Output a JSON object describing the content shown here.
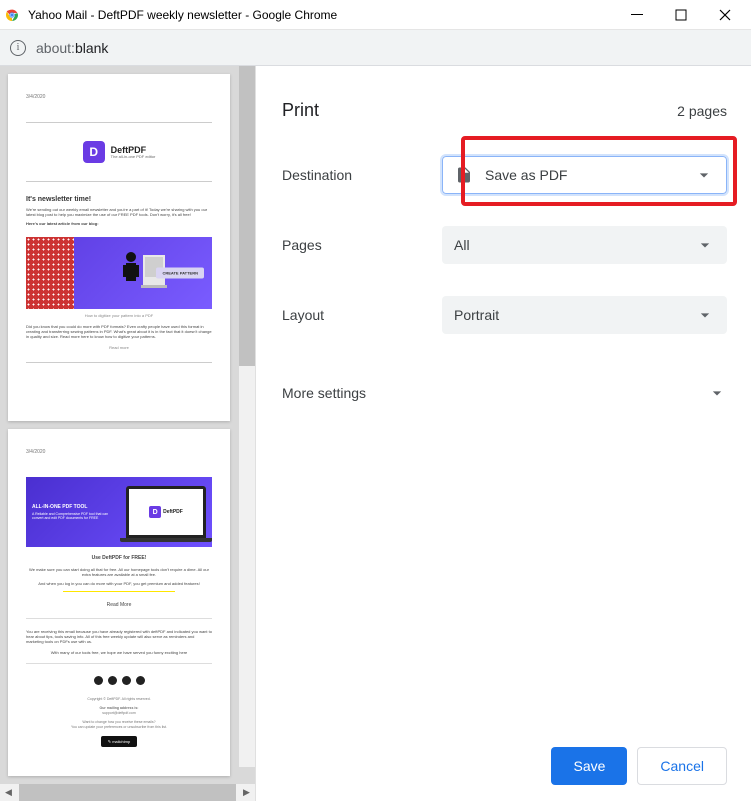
{
  "window": {
    "title": "Yahoo Mail - DeftPDF weekly newsletter - Google Chrome"
  },
  "address": {
    "about_prefix": "about:",
    "path": "blank"
  },
  "print": {
    "heading": "Print",
    "page_summary": "2 pages",
    "destination_label": "Destination",
    "destination_value": "Save as PDF",
    "pages_label": "Pages",
    "pages_value": "All",
    "layout_label": "Layout",
    "layout_value": "Portrait",
    "more_settings_label": "More settings",
    "save_btn": "Save",
    "cancel_btn": "Cancel"
  },
  "thumb1": {
    "logo_name": "DeftPDF",
    "logo_sub": "The all-in-one PDF editor",
    "h1": "It's newsletter time!",
    "p1": "We're sending out our weekly email newsletter and you're a part of it! Today we're sharing with you our latest blog post to help you maximize the use of our FREE PDF tools. Don't worry, it's all free!",
    "p2": "Here's our latest article from our blog:",
    "pill": "CREATE PATTERN",
    "caption": "How to digitize your pattern into a PDF",
    "p3": "Did you know that you could do more with PDF formats? Even crafty people have used this format in creating and transferring sewing patterns in PDF. What's great about it is in the fact that it doesn't change in quality and size. Read more here to know how to digitize your patterns.",
    "readmore": "Read more"
  },
  "thumb2": {
    "banner_title": "ALL-IN-ONE PDF TOOL",
    "banner_sub": "A Reliable and Comprehensive PDF tool that can convert and edit PDF documents for FREE",
    "use_free": "Use DeftPDF for FREE!",
    "p1": "We make sure you can start doing all that for free. All our homepage tools don't require a dime. All our extra features are available at a small fee.",
    "p2": "And when you log in you can do more with your PDF, you get premium and added features!",
    "readmore": "Read More",
    "p3": "You are receiving this email because you have already registered with deftPDF and indicated you want to hear about tips, tools saving info. All of this free weekly update will also serve as reminders and marketing tools on PDFs use with us.",
    "p4": "With many of our tools free, we hope we have served you funny exciting here",
    "footer1": "Copyright © DeftPDF. All rights reserved.",
    "footer2": "Our mailing address is:",
    "footer3": "support@deftpdf.com",
    "footer4": "Want to change how you receive these emails?",
    "footer5": "You can update your preferences or unsubscribe from this list.",
    "badge": "mailchimp"
  }
}
